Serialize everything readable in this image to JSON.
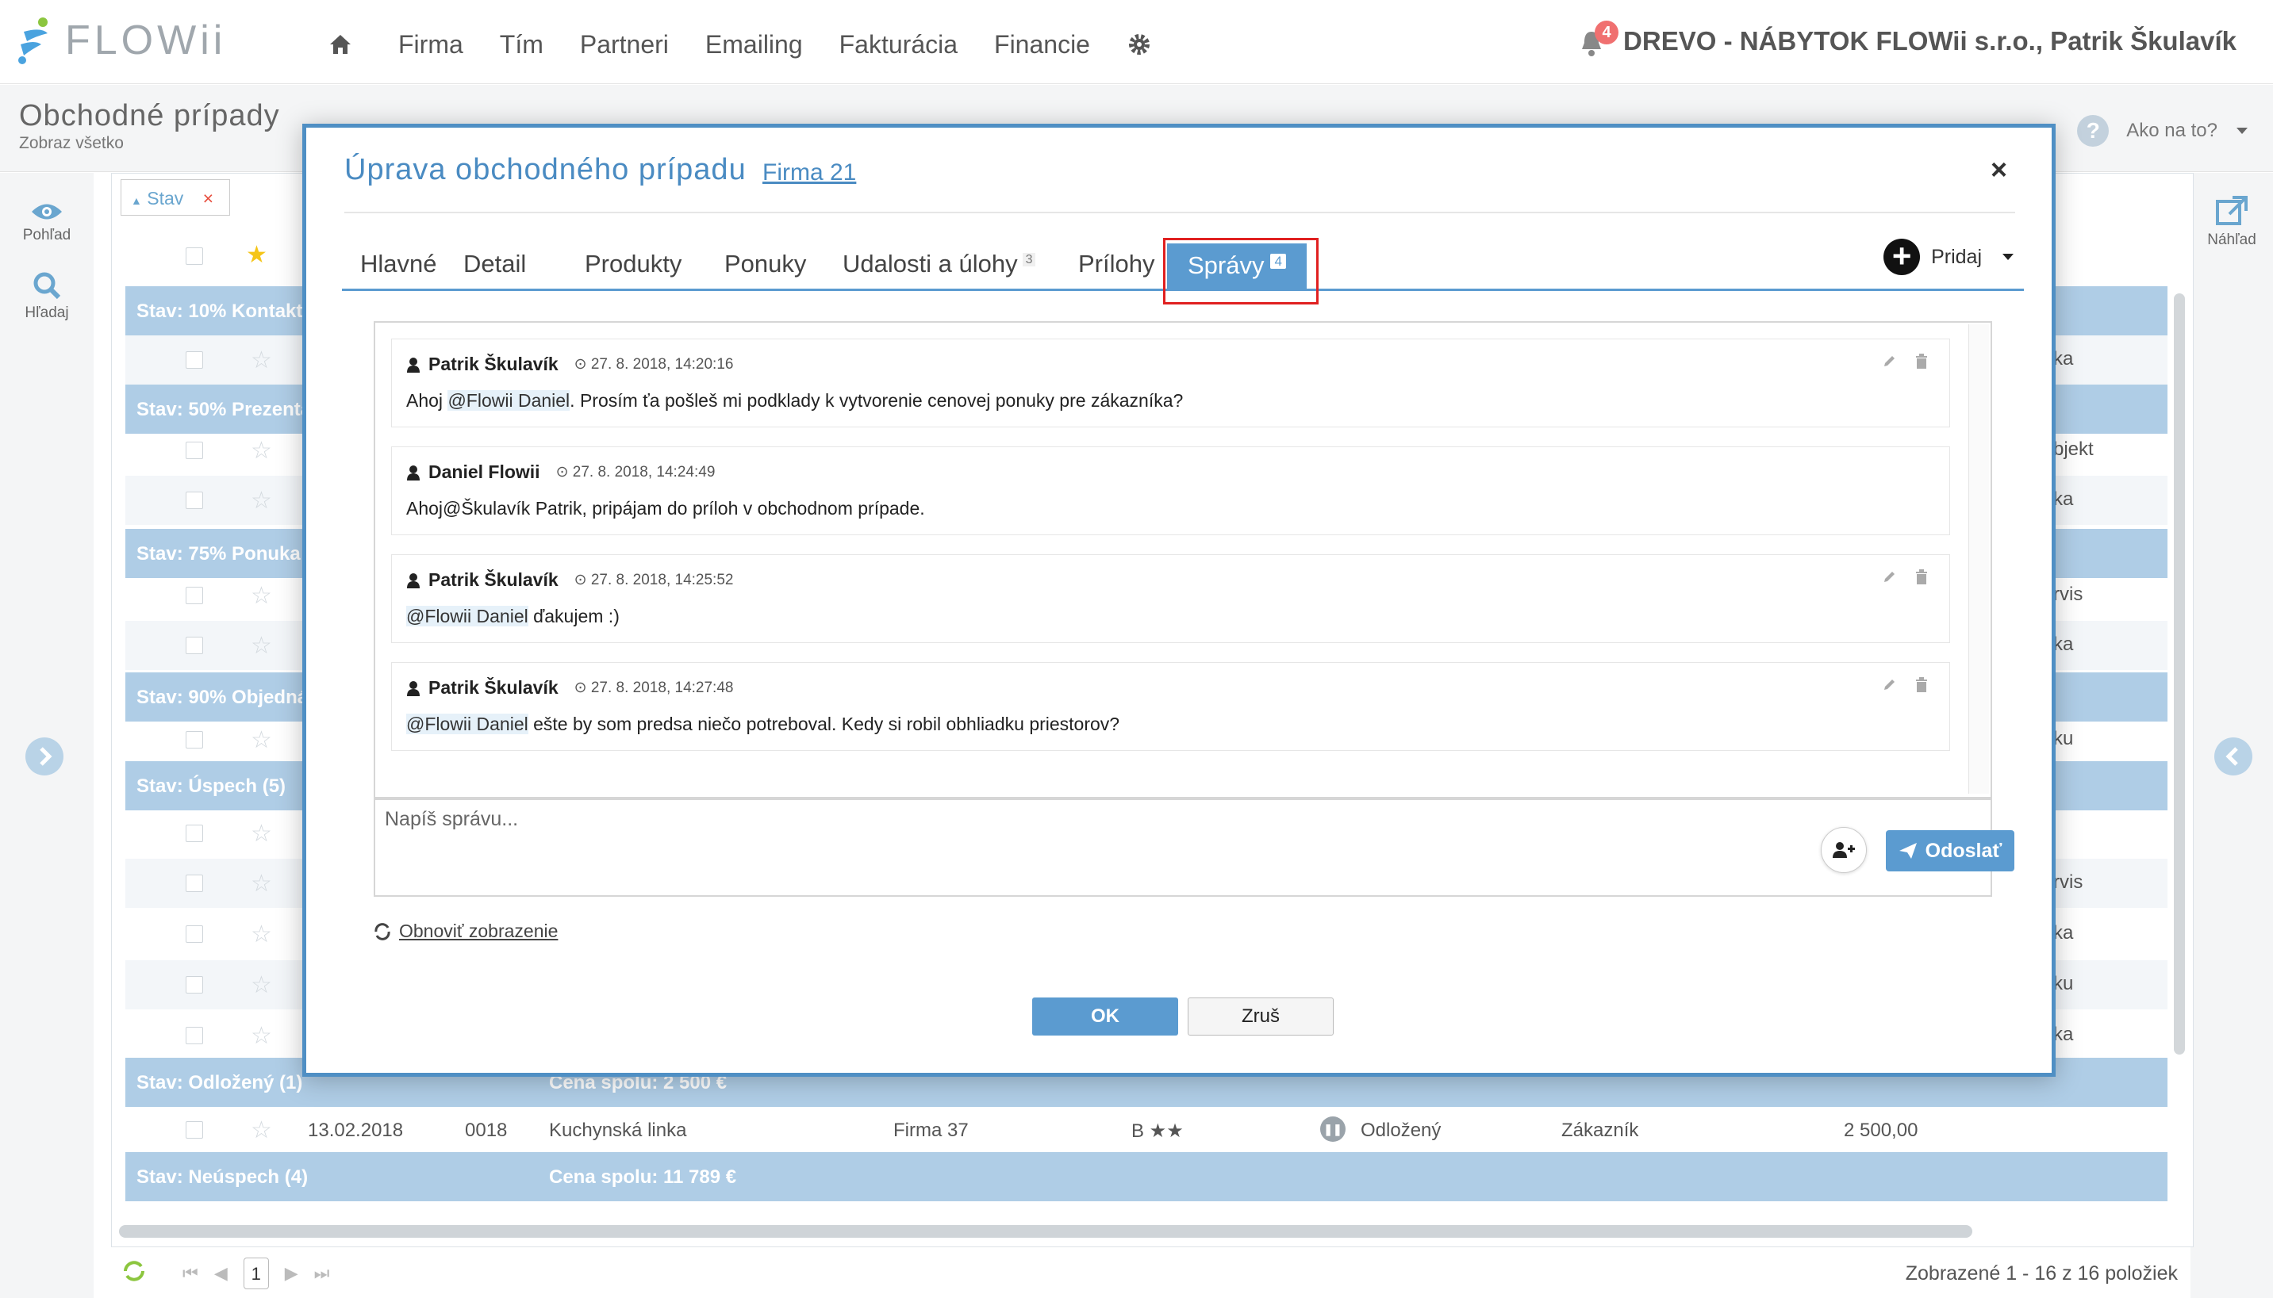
{
  "brand": {
    "name": "FLOWii"
  },
  "nav": {
    "items": [
      "Firma",
      "Tím",
      "Partneri",
      "Emailing",
      "Fakturácia",
      "Financie"
    ],
    "notifications": "4",
    "company_user": "DREVO - NÁBYTOK FLOWii s.r.o., Patrik Škulavík"
  },
  "page": {
    "title": "Obchodné prípady",
    "subtitle": "Zobraz všetko",
    "help": "Ako na to?"
  },
  "rail": {
    "view": "Pohľad",
    "search": "Hľadaj",
    "preview": "Náhľad"
  },
  "grid": {
    "filter_label": "Stav",
    "groups": [
      {
        "label": "Stav: 10% Kontakt (",
        "sum": ""
      },
      {
        "label": "Stav: 50% Prezentá",
        "sum": ""
      },
      {
        "label": "Stav: 75% Ponuka (",
        "sum": ""
      },
      {
        "label": "Stav: 90% Objednáv",
        "sum": ""
      },
      {
        "label": "Stav: Úspech (5)",
        "sum": ""
      },
      {
        "label": "Stav: Odložený (1)",
        "sum": "Cena spolu: 2 500 €"
      },
      {
        "label": "Stav: Neúspech (4)",
        "sum": "Cena spolu: 11 789 €"
      }
    ],
    "right_texts": [
      "ka",
      "bjekt",
      "ka",
      "rvis",
      "ka",
      "ku",
      "rvis",
      "ka",
      "ku",
      "ka"
    ],
    "postponed_row": {
      "date": "13.02.2018",
      "number": "0018",
      "name": "Kuchynská linka",
      "firm": "Firma 37",
      "rating": "B ★★",
      "status": "Odložený",
      "type": "Zákazník",
      "price": "2 500,00"
    },
    "footer": {
      "page": "1",
      "shown": "Zobrazené 1 - 16 z 16 položiek"
    }
  },
  "modal": {
    "title": "Úprava obchodného prípadu",
    "firm_link": "Firma 21",
    "tabs": [
      {
        "label": "Hlavné",
        "count": ""
      },
      {
        "label": "Detail",
        "count": ""
      },
      {
        "label": "Produkty",
        "count": ""
      },
      {
        "label": "Ponuky",
        "count": ""
      },
      {
        "label": "Udalosti a úlohy",
        "count": "3"
      },
      {
        "label": "Prílohy",
        "count": ""
      },
      {
        "label": "Správy",
        "count": "4"
      }
    ],
    "add_label": "Pridaj",
    "messages": [
      {
        "author": "Patrik Škulavík",
        "time": "27. 8. 2018, 14:20:16",
        "pre": "Ahoj ",
        "mention": "@Flowii Daniel",
        "post": ". Prosím ťa pošleš mi podklady k vytvorenie cenovej ponuky pre zákazníka?"
      },
      {
        "author": "Daniel Flowii",
        "time": "27. 8. 2018, 14:24:49",
        "pre": "Ahoj@Škulavík Patrik, pripájam do príloh v obchodnom prípade.",
        "mention": "",
        "post": ""
      },
      {
        "author": "Patrik Škulavík",
        "time": "27. 8. 2018, 14:25:52",
        "pre": "",
        "mention": "@Flowii Daniel",
        "post": " ďakujem :)"
      },
      {
        "author": "Patrik Škulavík",
        "time": "27. 8. 2018, 14:27:48",
        "pre": "",
        "mention": "@Flowii Daniel",
        "post": " ešte by som predsa niečo potreboval. Kedy si robil obhliadku priestorov?"
      }
    ],
    "composer_placeholder": "Napíš správu...",
    "send_label": "Odoslať",
    "refresh_label": "Obnoviť zobrazenie",
    "ok_label": "OK",
    "cancel_label": "Zruš"
  },
  "colors": {
    "accent": "#5b9bd0",
    "group_row": "#afcde6",
    "highlight": "#e02020"
  }
}
